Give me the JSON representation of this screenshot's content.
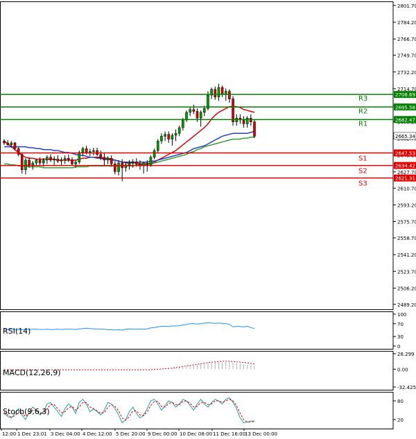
{
  "chart_data": {
    "type": "candlestick",
    "main_panel": {
      "ylim": [
        2484,
        2806
      ],
      "y_ticks": [
        "2801.70",
        "2784.20",
        "2766.70",
        "2749.70",
        "2732.20",
        "2714.70",
        "2697.20",
        "2680.20",
        "2662.70",
        "2645.20",
        "2627.70",
        "2610.70",
        "2593.20",
        "2575.70",
        "2558.70",
        "2541.20",
        "2523.70",
        "2506.20",
        "2489.20"
      ],
      "levels": [
        {
          "name": "R3",
          "value": 2708.69,
          "label": "2708.69",
          "color": "#008000"
        },
        {
          "name": "R2",
          "value": 2695.58,
          "label": "2695.58",
          "color": "#008000"
        },
        {
          "name": "R1",
          "value": 2682.47,
          "label": "2682.47",
          "color": "#008000"
        },
        {
          "name": "S1",
          "value": 2647.53,
          "label": "2647.53",
          "color": "#e00000"
        },
        {
          "name": "S2",
          "value": 2634.42,
          "label": "2634.42",
          "color": "#e00000"
        },
        {
          "name": "S3",
          "value": 2621.31,
          "label": "2621.31",
          "color": "#e00000"
        }
      ],
      "current_price": {
        "value": 2665.34,
        "label": "2665.34"
      },
      "candles": [
        [
          2660,
          2662,
          2656,
          2658
        ],
        [
          2658,
          2661,
          2655,
          2656
        ],
        [
          2656,
          2660,
          2653,
          2658
        ],
        [
          2658,
          2659,
          2650,
          2652
        ],
        [
          2652,
          2654,
          2644,
          2646
        ],
        [
          2646,
          2648,
          2626,
          2630
        ],
        [
          2630,
          2642,
          2625,
          2640
        ],
        [
          2640,
          2643,
          2632,
          2635
        ],
        [
          2635,
          2639,
          2630,
          2637
        ],
        [
          2637,
          2641,
          2634,
          2640
        ],
        [
          2640,
          2643,
          2635,
          2637
        ],
        [
          2637,
          2642,
          2633,
          2640
        ],
        [
          2640,
          2645,
          2636,
          2643
        ],
        [
          2643,
          2646,
          2638,
          2640
        ],
        [
          2640,
          2644,
          2635,
          2641
        ],
        [
          2641,
          2645,
          2637,
          2639
        ],
        [
          2639,
          2643,
          2635,
          2640
        ],
        [
          2640,
          2645,
          2636,
          2642
        ],
        [
          2642,
          2646,
          2638,
          2640
        ],
        [
          2640,
          2643,
          2634,
          2636
        ],
        [
          2636,
          2640,
          2632,
          2638
        ],
        [
          2638,
          2650,
          2636,
          2648
        ],
        [
          2648,
          2654,
          2644,
          2652
        ],
        [
          2652,
          2655,
          2646,
          2648
        ],
        [
          2648,
          2652,
          2644,
          2649
        ],
        [
          2649,
          2653,
          2645,
          2650
        ],
        [
          2650,
          2653,
          2644,
          2646
        ],
        [
          2646,
          2650,
          2640,
          2643
        ],
        [
          2643,
          2647,
          2634,
          2640
        ],
        [
          2640,
          2644,
          2636,
          2642
        ],
        [
          2642,
          2645,
          2633,
          2636
        ],
        [
          2636,
          2639,
          2625,
          2628
        ],
        [
          2628,
          2640,
          2624,
          2637
        ],
        [
          2637,
          2641,
          2618,
          2632
        ],
        [
          2632,
          2638,
          2628,
          2635
        ],
        [
          2635,
          2640,
          2630,
          2637
        ],
        [
          2637,
          2641,
          2632,
          2638
        ],
        [
          2638,
          2642,
          2633,
          2636
        ],
        [
          2636,
          2640,
          2630,
          2634
        ],
        [
          2634,
          2638,
          2626,
          2637
        ],
        [
          2637,
          2640,
          2628,
          2635
        ],
        [
          2635,
          2645,
          2633,
          2643
        ],
        [
          2643,
          2652,
          2641,
          2650
        ],
        [
          2650,
          2662,
          2648,
          2660
        ],
        [
          2660,
          2668,
          2657,
          2665
        ],
        [
          2665,
          2670,
          2660,
          2667
        ],
        [
          2667,
          2670,
          2658,
          2662
        ],
        [
          2662,
          2668,
          2655,
          2666
        ],
        [
          2666,
          2672,
          2660,
          2668
        ],
        [
          2668,
          2676,
          2665,
          2674
        ],
        [
          2674,
          2684,
          2671,
          2682
        ],
        [
          2682,
          2692,
          2680,
          2690
        ],
        [
          2690,
          2696,
          2686,
          2693
        ],
        [
          2693,
          2698,
          2688,
          2691
        ],
        [
          2691,
          2694,
          2680,
          2684
        ],
        [
          2684,
          2692,
          2675,
          2690
        ],
        [
          2690,
          2697,
          2686,
          2694
        ],
        [
          2694,
          2712,
          2692,
          2708
        ],
        [
          2708,
          2716,
          2704,
          2714
        ],
        [
          2714,
          2717,
          2703,
          2706
        ],
        [
          2706,
          2720,
          2702,
          2716
        ],
        [
          2716,
          2718,
          2706,
          2709
        ],
        [
          2709,
          2715,
          2702,
          2712
        ],
        [
          2712,
          2714,
          2700,
          2704
        ],
        [
          2704,
          2707,
          2676,
          2680
        ],
        [
          2680,
          2688,
          2676,
          2684
        ],
        [
          2684,
          2688,
          2678,
          2682
        ],
        [
          2682,
          2686,
          2674,
          2678
        ],
        [
          2678,
          2686,
          2674,
          2684
        ],
        [
          2684,
          2688,
          2676,
          2680
        ],
        [
          2680,
          2683,
          2663,
          2665
        ]
      ],
      "moving_averages": [
        {
          "color": "#e00000",
          "values": [
            2660,
            2657,
            2654,
            2651,
            2648,
            2645,
            2643,
            2642,
            2642,
            2641,
            2641,
            2641,
            2641,
            2641,
            2641,
            2640,
            2640,
            2640,
            2640,
            2640,
            2640,
            2641,
            2642,
            2642,
            2643,
            2643,
            2643,
            2643,
            2642,
            2642,
            2641,
            2640,
            2639,
            2638,
            2637,
            2637,
            2637,
            2637,
            2636,
            2636,
            2636,
            2637,
            2638,
            2640,
            2642,
            2644,
            2646,
            2648,
            2650,
            2653,
            2656,
            2659,
            2662,
            2665,
            2668,
            2671,
            2674,
            2678,
            2683,
            2687,
            2690,
            2692,
            2694,
            2696,
            2696,
            2696,
            2695,
            2693,
            2692,
            2691,
            2690
          ]
        },
        {
          "color": "#2040d0",
          "values": [
            2654,
            2654,
            2654,
            2654,
            2654,
            2654,
            2654,
            2653,
            2653,
            2652,
            2652,
            2651,
            2651,
            2651,
            2650,
            2650,
            2649,
            2648,
            2648,
            2647,
            2646,
            2645,
            2645,
            2644,
            2643,
            2643,
            2642,
            2642,
            2641,
            2641,
            2640,
            2640,
            2639,
            2638,
            2638,
            2638,
            2638,
            2638,
            2638,
            2638,
            2638,
            2639,
            2639,
            2640,
            2641,
            2642,
            2643,
            2644,
            2645,
            2646,
            2647,
            2648,
            2650,
            2652,
            2653,
            2654,
            2655,
            2657,
            2659,
            2661,
            2663,
            2665,
            2666,
            2667,
            2668,
            2668,
            2668,
            2668,
            2668,
            2669,
            2670
          ]
        },
        {
          "color": "#30a030",
          "values": [
            2636,
            2636,
            2635,
            2635,
            2634,
            2634,
            2634,
            2633,
            2633,
            2633,
            2633,
            2632,
            2632,
            2632,
            2632,
            2632,
            2632,
            2632,
            2632,
            2632,
            2633,
            2633,
            2633,
            2633,
            2634,
            2634,
            2634,
            2634,
            2634,
            2634,
            2634,
            2634,
            2634,
            2634,
            2634,
            2634,
            2634,
            2635,
            2635,
            2635,
            2636,
            2636,
            2637,
            2638,
            2639,
            2640,
            2641,
            2642,
            2643,
            2644,
            2645,
            2646,
            2648,
            2649,
            2651,
            2652,
            2654,
            2655,
            2656,
            2657,
            2658,
            2659,
            2660,
            2661,
            2662,
            2662,
            2662,
            2663,
            2663,
            2664,
            2664
          ]
        }
      ]
    },
    "rsi_panel": {
      "label": "RSI(14)",
      "ylim": [
        0,
        100
      ],
      "y_ticks": [
        "100",
        "70",
        "30",
        "0"
      ],
      "values": [
        52,
        52,
        53,
        52,
        51,
        51,
        52,
        52,
        53,
        53,
        52,
        52,
        53,
        52,
        52,
        53,
        52,
        53,
        53,
        53,
        52,
        54,
        55,
        56,
        55,
        54,
        54,
        53,
        53,
        51,
        51,
        50,
        51,
        50,
        53,
        54,
        53,
        53,
        54,
        53,
        54,
        57,
        58,
        60,
        62,
        62,
        61,
        63,
        63,
        64,
        66,
        68,
        70,
        70,
        69,
        70,
        72,
        73,
        72,
        71,
        72,
        71,
        70,
        68,
        60,
        62,
        61,
        60,
        62,
        58,
        55
      ]
    },
    "macd_panel": {
      "label": "MACD(12,26,9)",
      "ylim": [
        -32.425,
        28.299
      ],
      "y_ticks": [
        "28.299",
        "0.00",
        "-32.425"
      ],
      "histogram": [
        0,
        0,
        0,
        0,
        0,
        0,
        0,
        0,
        0,
        0,
        0,
        0,
        0,
        0,
        0,
        0,
        0,
        0,
        0,
        0,
        0,
        0,
        0,
        0,
        0,
        0,
        0,
        0,
        0,
        0,
        0,
        0,
        0,
        0,
        0,
        0,
        0,
        0,
        0,
        0,
        0,
        0,
        0,
        0,
        0,
        1,
        1.5,
        2,
        2.5,
        3,
        4,
        5,
        6,
        7,
        8,
        9,
        10,
        11,
        12,
        13,
        13,
        13,
        13,
        13,
        12,
        11,
        10,
        9,
        8,
        7,
        6
      ],
      "signal": [
        -1,
        -1,
        -1,
        -1,
        -1,
        -1,
        -1,
        -1,
        -1,
        -1,
        -1,
        -1,
        -1,
        -1,
        -1,
        -1,
        -1,
        -1,
        -1,
        -1,
        -1,
        -1,
        -1,
        -1,
        -1,
        -1,
        -1,
        -1,
        -1,
        -1,
        -1,
        -1,
        -1,
        -1,
        -1,
        -1,
        -1,
        -1,
        -1,
        -1,
        -1,
        -1,
        0,
        0,
        0.5,
        1,
        1.5,
        2,
        3,
        4,
        5,
        6,
        7,
        8,
        9,
        10,
        11,
        12,
        13,
        13.5,
        14,
        14.5,
        14.5,
        14.5,
        14,
        13.5,
        13,
        12.5,
        11.5,
        10.5,
        9.5
      ]
    },
    "stoch_panel": {
      "label": "Stoch(9,6,3)",
      "ylim": [
        0,
        100
      ],
      "y_ticks": [
        "80",
        "20"
      ],
      "main": [
        40,
        30,
        25,
        40,
        55,
        35,
        20,
        45,
        60,
        50,
        35,
        45,
        70,
        75,
        60,
        45,
        30,
        55,
        70,
        60,
        40,
        75,
        85,
        70,
        45,
        55,
        45,
        35,
        50,
        75,
        70,
        55,
        35,
        10,
        20,
        45,
        60,
        40,
        25,
        35,
        55,
        80,
        85,
        70,
        50,
        65,
        80,
        75,
        60,
        70,
        85,
        80,
        65,
        50,
        70,
        85,
        70,
        60,
        75,
        85,
        80,
        70,
        85,
        90,
        75,
        55,
        25,
        10,
        12,
        15,
        15
      ],
      "signal": [
        45,
        35,
        28,
        32,
        45,
        40,
        30,
        38,
        50,
        52,
        42,
        42,
        55,
        68,
        68,
        55,
        42,
        45,
        58,
        62,
        50,
        60,
        75,
        75,
        60,
        55,
        48,
        40,
        42,
        60,
        68,
        62,
        48,
        25,
        18,
        30,
        48,
        48,
        35,
        32,
        45,
        65,
        78,
        78,
        62,
        60,
        72,
        75,
        68,
        68,
        78,
        80,
        72,
        60,
        62,
        75,
        75,
        68,
        70,
        80,
        80,
        75,
        80,
        85,
        80,
        65,
        40,
        20,
        12,
        13,
        14
      ]
    },
    "x_ticks": [
      "12:00",
      "1 Dec 23:01",
      "3 Dec 04:00",
      "4 Dec 12:00",
      "5 Dec 20:00",
      "9 Dec 00:00",
      "10 Dec 08:00",
      "11 Dec 16:00",
      "13 Dec 00:00"
    ]
  }
}
